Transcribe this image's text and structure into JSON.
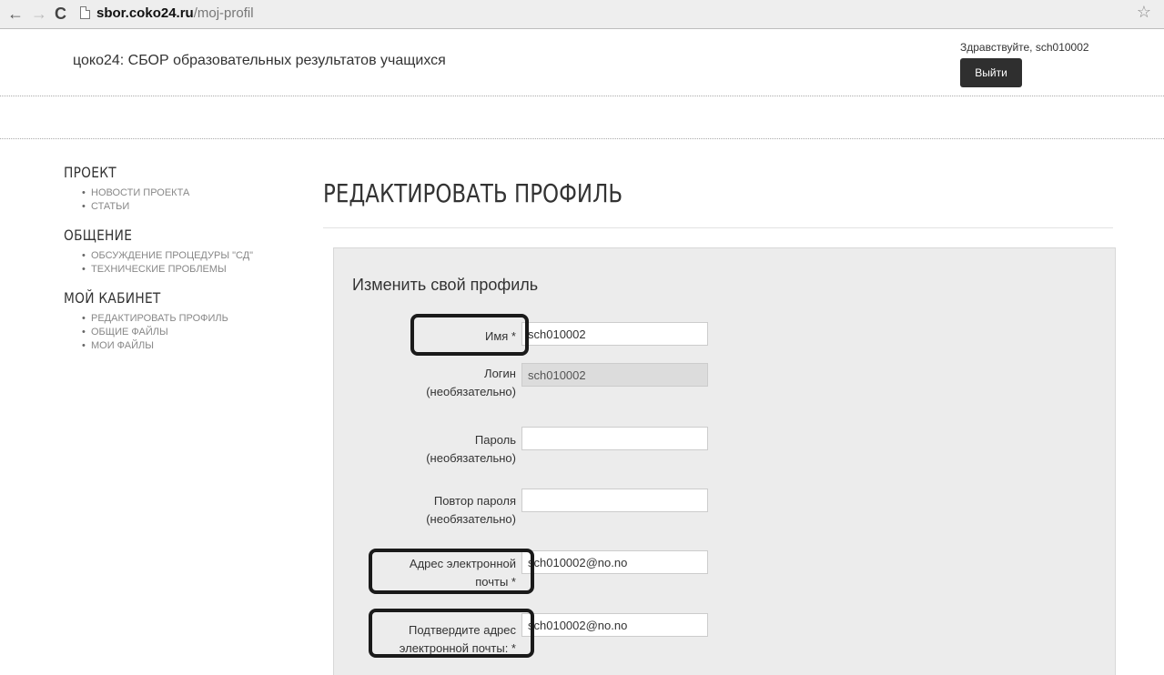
{
  "browser": {
    "back_icon": "←",
    "forward_icon": "→",
    "reload_icon": "C",
    "url_host": "sbor.coko24.ru",
    "url_path": "/moj-profil",
    "star_icon": "☆"
  },
  "header": {
    "site_title": "цоко24: СБОР образовательных результатов учащихся",
    "greeting": "Здравствуйте, sch010002",
    "logout_label": "Выйти"
  },
  "sidebar": {
    "sections": [
      {
        "title": "ПРОЕКТ",
        "items": [
          "НОВОСТИ ПРОЕКТА",
          "СТАТЬИ"
        ]
      },
      {
        "title": "ОБЩЕНИЕ",
        "items": [
          "ОБСУЖДЕНИЕ ПРОЦЕДУРЫ \"СД\"",
          "ТЕХНИЧЕСКИЕ ПРОБЛЕМЫ"
        ]
      },
      {
        "title": "МОЙ КАБИНЕТ",
        "items": [
          "РЕДАКТИРОВАТЬ ПРОФИЛЬ",
          "ОБЩИЕ ФАЙЛЫ",
          "МОИ ФАЙЛЫ"
        ]
      }
    ],
    "bullet": "•"
  },
  "main": {
    "page_title": "РЕДАКТИРОВАТЬ ПРОФИЛЬ",
    "form_heading": "Изменить свой профиль",
    "fields": {
      "name": {
        "label": "Имя *",
        "value": "sch010002"
      },
      "login": {
        "label_line1": "Логин",
        "label_line2": "(необязательно)",
        "value": "sch010002"
      },
      "password": {
        "label_line1": "Пароль",
        "label_line2": "(необязательно)",
        "value": ""
      },
      "password_repeat": {
        "label_line1": "Повтор пароля",
        "label_line2": "(необязательно)",
        "value": ""
      },
      "email": {
        "label_line1": "Адрес электронной",
        "label_line2": "почты *",
        "value": "sch010002@no.no"
      },
      "email_confirm": {
        "label_line1": "Подтвердите адрес",
        "label_line2": "электронной почты: *",
        "value": "sch010002@no.no"
      }
    }
  }
}
